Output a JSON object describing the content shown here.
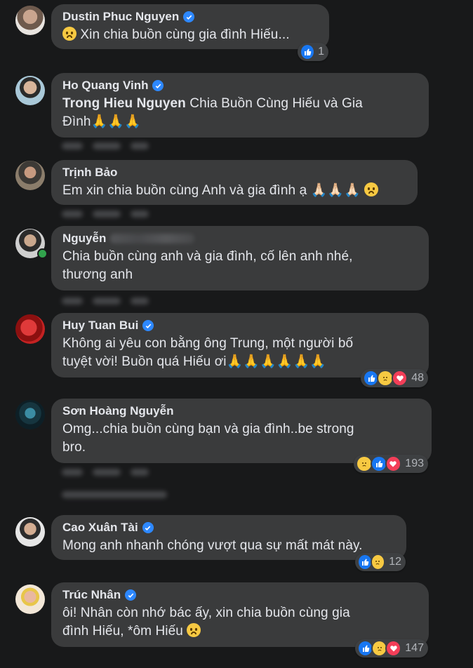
{
  "comments": [
    {
      "author": "Dustin Phuc Nguyen",
      "verified": true,
      "text": "Xin chia buồn cùng gia đình Hiếu...",
      "reaction_count": "1"
    },
    {
      "author": "Ho Quang Vinh",
      "verified": true,
      "mention": "Trong Hieu Nguyen",
      "text": "Chia Buồn Cùng Hiếu và Gia",
      "text2": "Đình🙏🙏🙏"
    },
    {
      "author": "Trịnh Bảo",
      "verified": false,
      "text": "Em xin chia buồn cùng Anh và gia đình ạ 🙏🏻🙏🏻🙏🏻"
    },
    {
      "author": "Nguyễn",
      "verified": false,
      "text": "Chia buồn cùng anh và gia đình, cố lên anh nhé,",
      "text2": "thương anh"
    },
    {
      "author": "Huy Tuan Bui",
      "verified": true,
      "text": "Không ai yêu con bằng ông Trung, một người bố",
      "text2": "tuyệt vời! Buồn quá Hiếu ơi🙏🙏🙏🙏🙏🙏",
      "reaction_count": "48"
    },
    {
      "author": "Sơn Hoàng Nguyễn",
      "verified": false,
      "text": "Omg...chia buồn cùng bạn và gia đình..be strong",
      "text2": "bro.",
      "reaction_count": "193"
    },
    {
      "author": "Cao Xuân Tài",
      "verified": true,
      "text": "Mong anh nhanh chóng vượt qua sự mất mát này.",
      "reaction_count": "12"
    },
    {
      "author": "Trúc Nhân",
      "verified": true,
      "text": "ôi! Nhân còn nhớ bác ấy, xin chia buồn cùng gia",
      "text2": "đình Hiếu, *ôm Hiếu",
      "reaction_count": "147"
    }
  ],
  "icons": {
    "verified": "verified-badge-icon",
    "like": "like-reaction-icon",
    "sad": "sad-reaction-icon",
    "love": "love-reaction-icon"
  },
  "colors": {
    "background": "#18191a",
    "bubble": "#3a3b3c",
    "verified": "#2d88ff",
    "like": "#1877f2",
    "love": "#f33e58",
    "sad": "#f7c942"
  }
}
